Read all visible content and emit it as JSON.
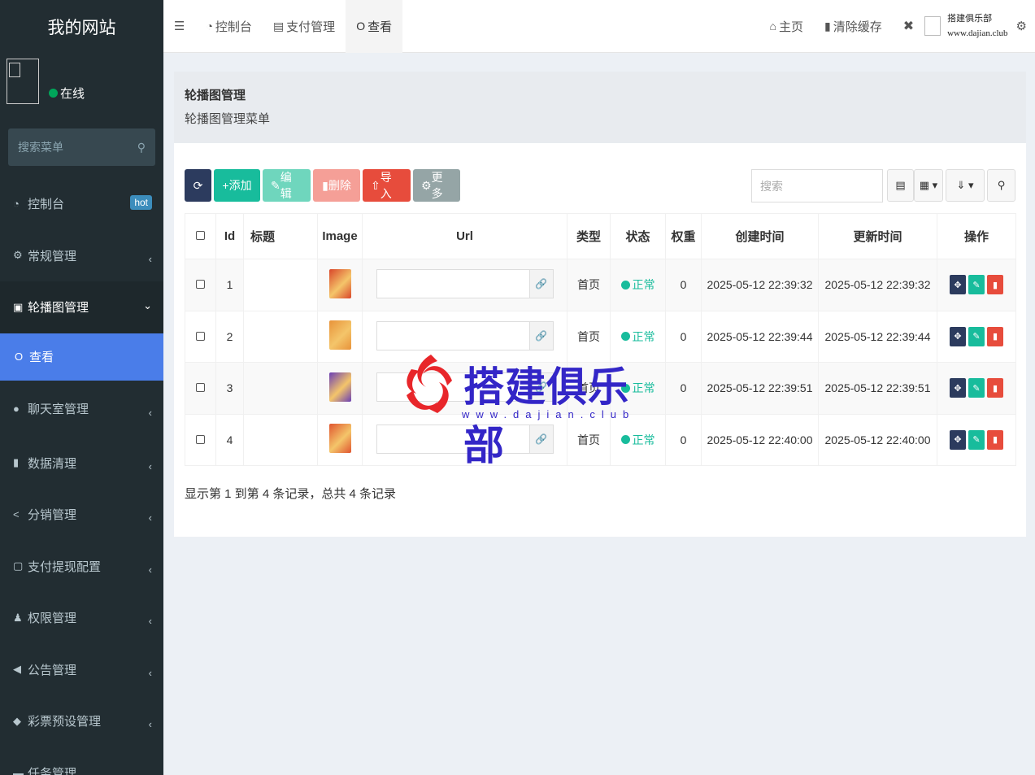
{
  "sidebar": {
    "logo": "我的网站",
    "status": "在线",
    "search_placeholder": "搜索菜单",
    "items": [
      {
        "icon": "dashboard-icon",
        "glyph": "◔",
        "label": "控制台",
        "badge": "hot"
      },
      {
        "icon": "cogs-icon",
        "glyph": "⚙",
        "label": "常规管理"
      },
      {
        "icon": "image-icon",
        "glyph": "▣",
        "label": "轮播图管理"
      },
      {
        "icon": "circle-icon",
        "glyph": "O",
        "label": "查看"
      },
      {
        "icon": "comment-icon",
        "glyph": "●",
        "label": "聊天室管理"
      },
      {
        "icon": "trash-icon",
        "glyph": "▮",
        "label": "数据清理"
      },
      {
        "icon": "share-icon",
        "glyph": "<",
        "label": "分销管理"
      },
      {
        "icon": "money-icon",
        "glyph": "▢",
        "label": "支付提现配置"
      },
      {
        "icon": "users-icon",
        "glyph": "♟",
        "label": "权限管理"
      },
      {
        "icon": "bullhorn-icon",
        "glyph": "◀",
        "label": "公告管理"
      },
      {
        "icon": "diamond-icon",
        "glyph": "◆",
        "label": "彩票预设管理"
      },
      {
        "icon": "tasks-icon",
        "glyph": "▬",
        "label": "任务管理"
      }
    ]
  },
  "header": {
    "nav": [
      {
        "glyph": "◔",
        "label": "控制台"
      },
      {
        "glyph": "▤",
        "label": "支付管理"
      },
      {
        "glyph": "O",
        "label": "查看"
      }
    ],
    "home": "主页",
    "clear_cache": "清除缓存",
    "brand_line1": "搭建俱乐部",
    "brand_line2": "www.dajian.club"
  },
  "content_header": {
    "title": "轮播图管理",
    "subtitle": "轮播图管理菜单"
  },
  "toolbar": {
    "add": "添加",
    "edit": "编辑",
    "delete": "删除",
    "import": "导入",
    "more": "更多",
    "search_placeholder": "搜索"
  },
  "table": {
    "columns": [
      "Id",
      "标题",
      "Image",
      "Url",
      "类型",
      "状态",
      "权重",
      "创建时间",
      "更新时间",
      "操作"
    ],
    "rows": [
      {
        "id": "1",
        "title": "",
        "thumb": "#d9462a",
        "type": "首页",
        "status": "正常",
        "weight": "0",
        "created": "2025-05-12 22:39:32",
        "updated": "2025-05-12 22:39:32"
      },
      {
        "id": "2",
        "title": "",
        "thumb": "#e8933a",
        "type": "首页",
        "status": "正常",
        "weight": "0",
        "created": "2025-05-12 22:39:44",
        "updated": "2025-05-12 22:39:44"
      },
      {
        "id": "3",
        "title": "",
        "thumb": "#6a3fb5",
        "type": "首页",
        "status": "正常",
        "weight": "0",
        "created": "2025-05-12 22:39:51",
        "updated": "2025-05-12 22:39:51"
      },
      {
        "id": "4",
        "title": "",
        "thumb": "#e0552f",
        "type": "首页",
        "status": "正常",
        "weight": "0",
        "created": "2025-05-12 22:40:00",
        "updated": "2025-05-12 22:40:00"
      }
    ],
    "pager_info": "显示第 1 到第 4 条记录，总共 4 条记录"
  },
  "watermark": {
    "title": "搭建俱乐部",
    "subtitle": "www.dajian.club"
  }
}
